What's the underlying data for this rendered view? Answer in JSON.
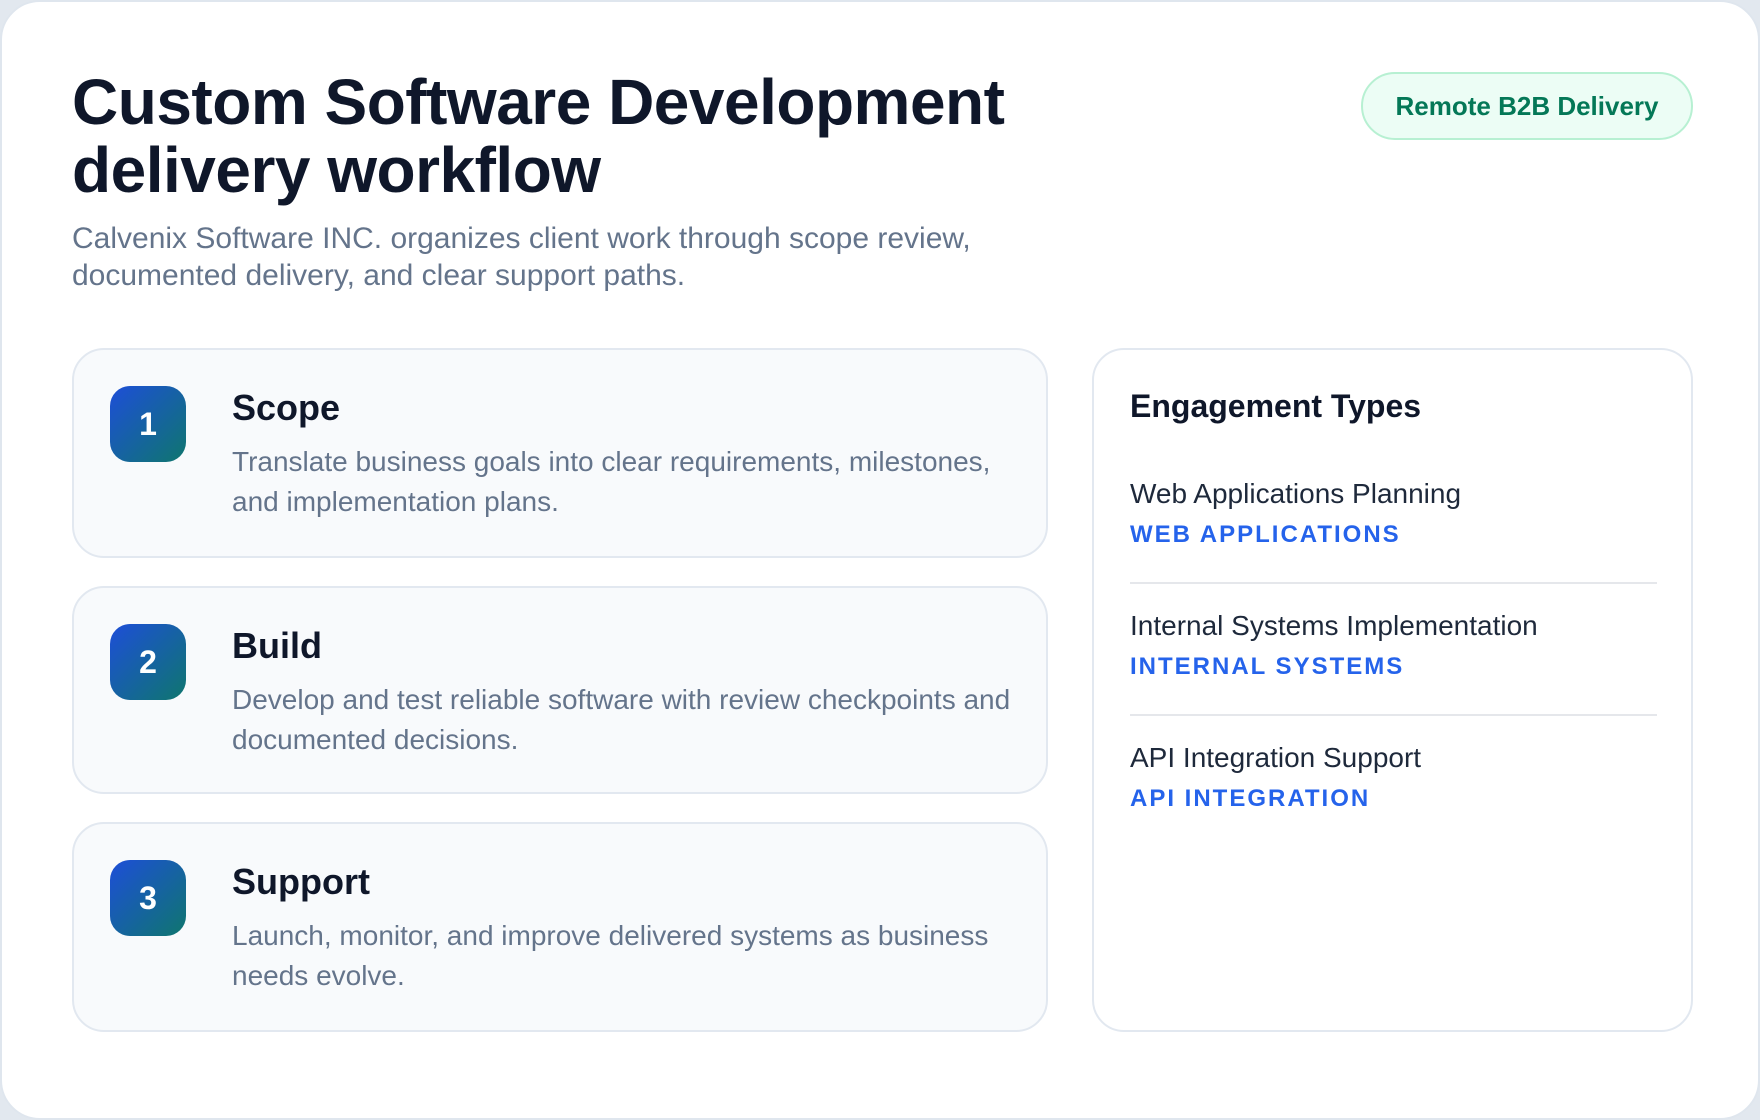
{
  "header": {
    "title": "Custom Software Development delivery workflow",
    "subtitle": "Calvenix Software INC. organizes client work through scope review, documented delivery, and clear support paths.",
    "badge": "Remote B2B Delivery"
  },
  "steps": [
    {
      "number": "1",
      "title": "Scope",
      "description": "Translate business goals into clear requirements, milestones, and implementation plans."
    },
    {
      "number": "2",
      "title": "Build",
      "description": "Develop and test reliable software with review checkpoints and documented decisions."
    },
    {
      "number": "3",
      "title": "Support",
      "description": "Launch, monitor, and improve delivered systems as business needs evolve."
    }
  ],
  "engagement": {
    "title": "Engagement Types",
    "items": [
      {
        "name": "Web Applications Planning",
        "tag": "WEB APPLICATIONS"
      },
      {
        "name": "Internal Systems Implementation",
        "tag": "INTERNAL SYSTEMS"
      },
      {
        "name": "API Integration Support",
        "tag": "API INTEGRATION"
      }
    ]
  },
  "colors": {
    "accent_blue": "#2563eb",
    "badge_green": "#047857",
    "heading": "#0f172a",
    "muted_text": "#64748b"
  }
}
